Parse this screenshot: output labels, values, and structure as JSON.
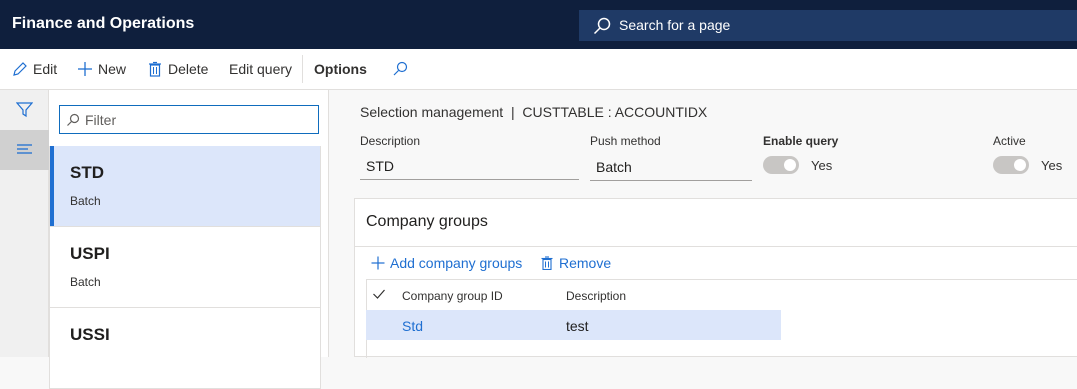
{
  "app": {
    "title": "Finance and Operations"
  },
  "search": {
    "placeholder": "Search for a page",
    "icon": "search-icon"
  },
  "toolbar": {
    "edit": "Edit",
    "new": "New",
    "delete": "Delete",
    "edit_query": "Edit query",
    "options": "Options"
  },
  "list": {
    "filter_placeholder": "Filter",
    "items": [
      {
        "title": "STD",
        "subtitle": "Batch",
        "selected": true
      },
      {
        "title": "USPI",
        "subtitle": "Batch",
        "selected": false
      },
      {
        "title": "USSI",
        "subtitle": "",
        "selected": false
      }
    ]
  },
  "detail": {
    "breadcrumb": "Selection management  |  CUSTTABLE : ACCOUNTIDX",
    "fields": {
      "description_label": "Description",
      "description_value": "STD",
      "push_method_label": "Push method",
      "push_method_value": "Batch",
      "enable_query_label": "Enable query",
      "enable_query_value": "Yes",
      "active_label": "Active",
      "active_value": "Yes"
    },
    "company_groups": {
      "title": "Company groups",
      "add_label": "Add company groups",
      "remove_label": "Remove",
      "columns": [
        "Company group ID",
        "Description"
      ],
      "rows": [
        {
          "id": "Std",
          "description": "test"
        }
      ]
    }
  },
  "colors": {
    "topbar": "#0f1f3d",
    "accent": "#1f6fd1",
    "selected_bg": "#dce6fa"
  }
}
